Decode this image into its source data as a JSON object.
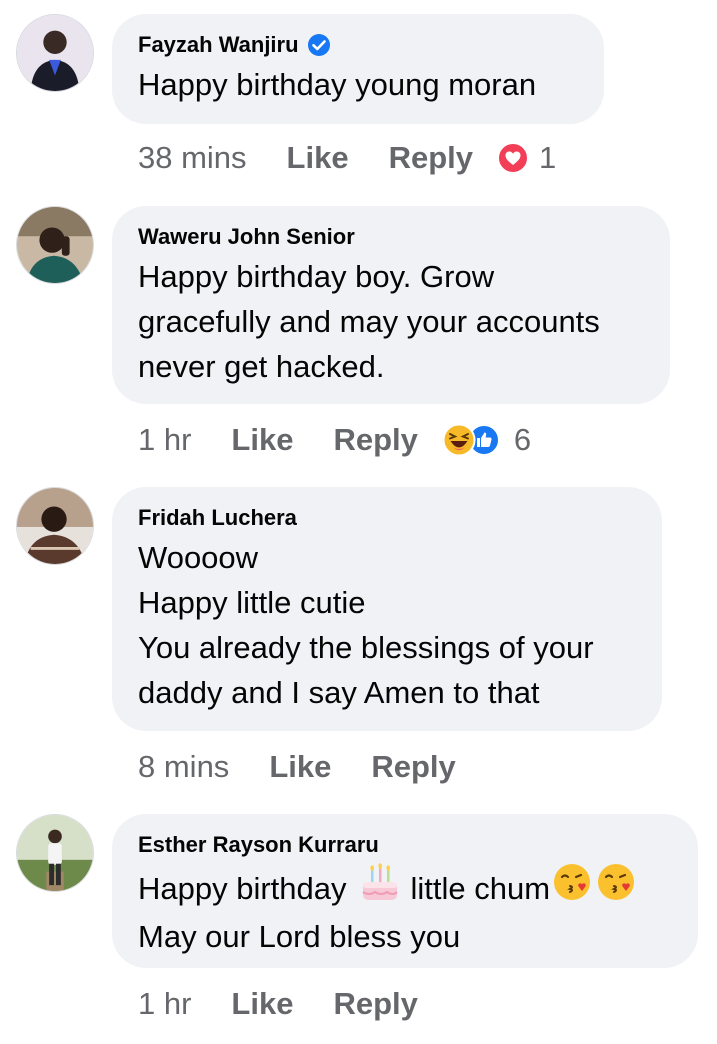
{
  "comments": [
    {
      "author": "Fayzah Wanjiru",
      "verified": true,
      "lines": [
        "Happy birthday young moran"
      ],
      "time": "38 mins",
      "like_label": "Like",
      "reply_label": "Reply",
      "reaction_icons": [
        "love-reaction-icon"
      ],
      "reaction_count": "1"
    },
    {
      "author": "Waweru John Senior",
      "verified": false,
      "lines": [
        "Happy birthday boy. Grow",
        "gracefully and may your accounts",
        "never get hacked."
      ],
      "time": "1 hr",
      "like_label": "Like",
      "reply_label": "Reply",
      "reaction_icons": [
        "haha-reaction-icon",
        "like-reaction-icon"
      ],
      "reaction_count": "6"
    },
    {
      "author": "Fridah Luchera",
      "verified": false,
      "lines": [
        "Woooow",
        "Happy little cutie",
        "You already the blessings of your",
        "daddy and I say Amen to that"
      ],
      "time": "8 mins",
      "like_label": "Like",
      "reply_label": "Reply"
    },
    {
      "author": "Esther Rayson Kurraru",
      "verified": false,
      "lines": [
        "Happy birthday",
        "little chum",
        "May our Lord bless you"
      ],
      "line1_emojis": [
        "birthday-cake-emoji",
        "kiss-face-emoji",
        "kiss-face-emoji"
      ],
      "time": "1 hr",
      "like_label": "Like",
      "reply_label": "Reply"
    }
  ],
  "colors": {
    "bubble": "#f0f2f5",
    "meta_text": "#65676b",
    "verified_blue": "#1877f2",
    "love_red": "#f33e58",
    "like_blue": "#1877f2",
    "haha_yellow": "#f7b928"
  }
}
